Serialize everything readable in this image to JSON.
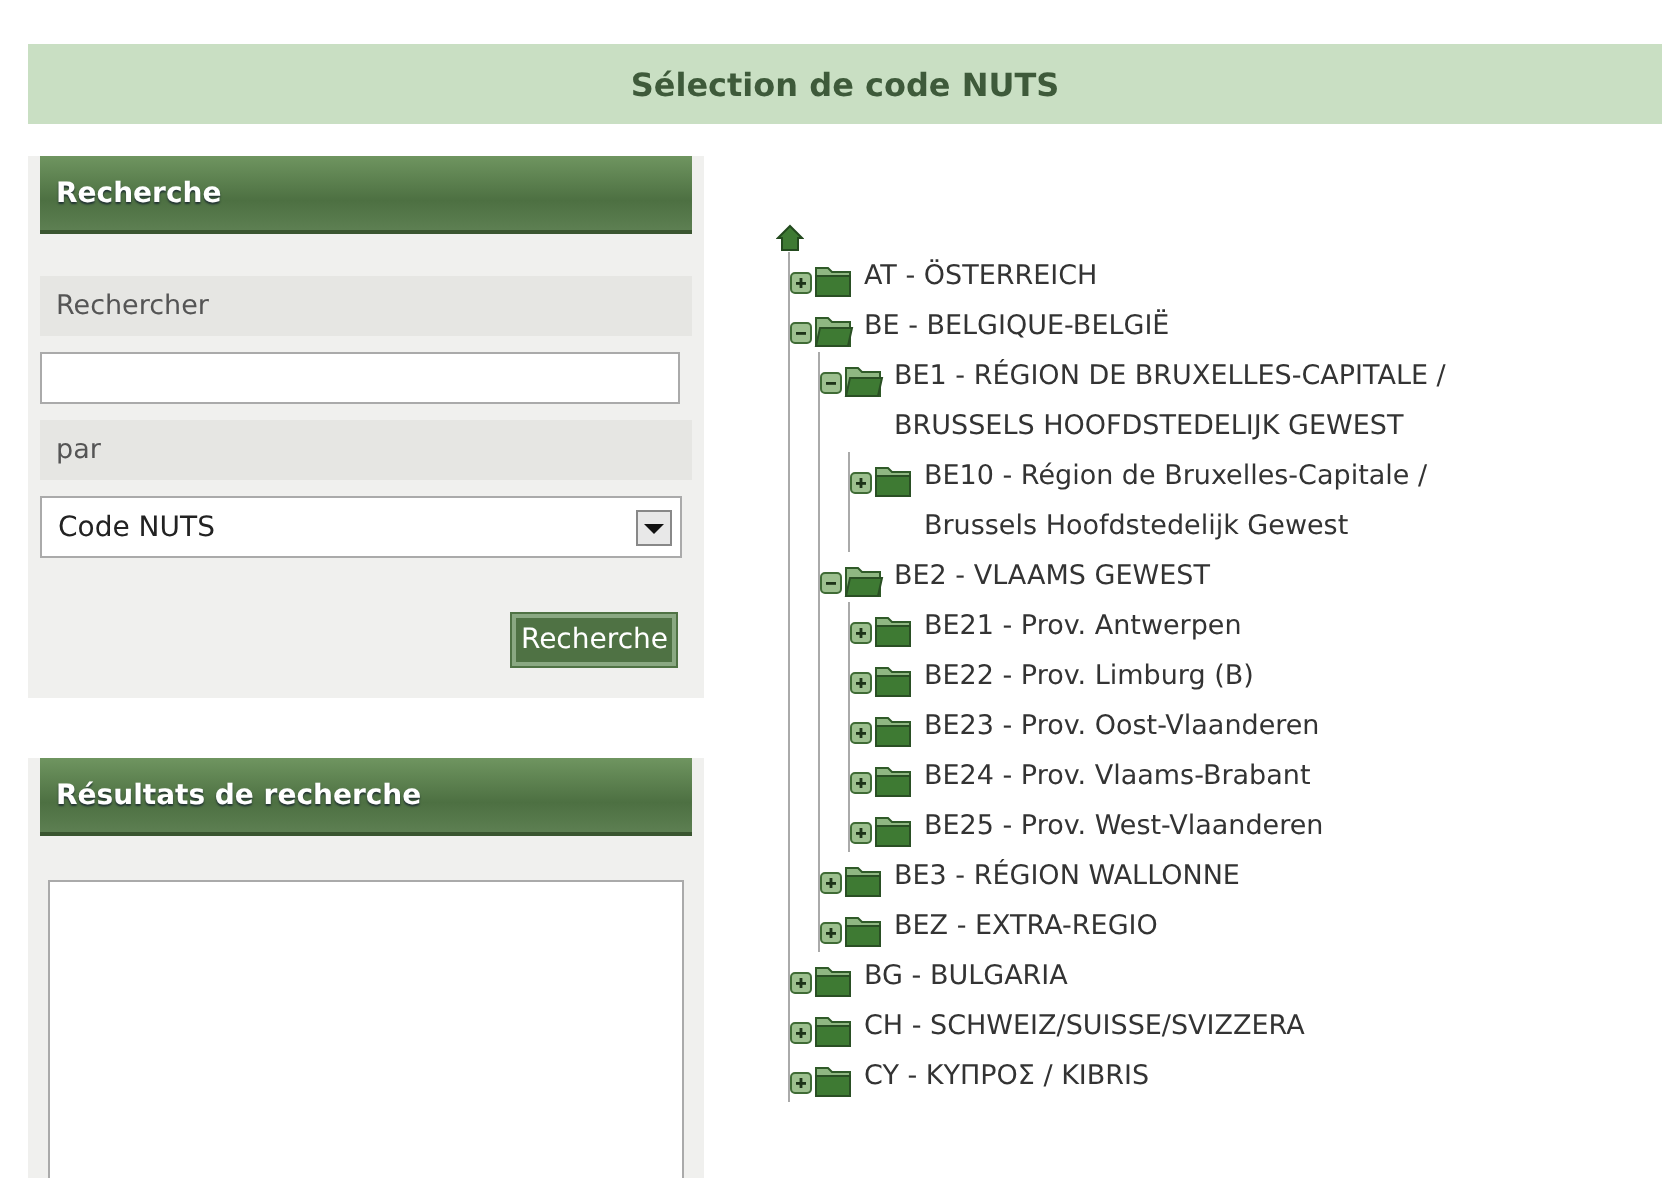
{
  "page_title": "Sélection de code NUTS",
  "search_panel": {
    "title": "Recherche",
    "query_label": "Rechercher",
    "by_label": "par",
    "by_value": "Code NUTS",
    "button": "Recherche"
  },
  "results_panel": {
    "title": "Résultats de recherche"
  },
  "tree": [
    {
      "label": "AT - ÖSTERREICH",
      "expanded": false
    },
    {
      "label": "BE - BELGIQUE-BELGIË",
      "expanded": true,
      "children": [
        {
          "label": "BE1 - RÉGION DE BRUXELLES-CAPITALE / BRUSSELS HOOFDSTEDELIJK GEWEST",
          "expanded": true,
          "children": [
            {
              "label": "BE10 - Région de Bruxelles-Capitale / Brussels Hoofdstedelijk Gewest",
              "expanded": false
            }
          ]
        },
        {
          "label": "BE2 - VLAAMS GEWEST",
          "expanded": true,
          "children": [
            {
              "label": "BE21 - Prov. Antwerpen",
              "expanded": false
            },
            {
              "label": "BE22 - Prov. Limburg (B)",
              "expanded": false
            },
            {
              "label": "BE23 - Prov. Oost-Vlaanderen",
              "expanded": false
            },
            {
              "label": "BE24 - Prov. Vlaams-Brabant",
              "expanded": false
            },
            {
              "label": "BE25 - Prov. West-Vlaanderen",
              "expanded": false
            }
          ]
        },
        {
          "label": "BE3 - RÉGION WALLONNE",
          "expanded": false
        },
        {
          "label": "BEZ - EXTRA-REGIO",
          "expanded": false
        }
      ]
    },
    {
      "label": "BG - BULGARIA",
      "expanded": false
    },
    {
      "label": "CH - SCHWEIZ/SUISSE/SVIZZERA",
      "expanded": false
    },
    {
      "label": "CY - ΚΥΠΡΟΣ / KIBRIS",
      "expanded": false
    }
  ]
}
